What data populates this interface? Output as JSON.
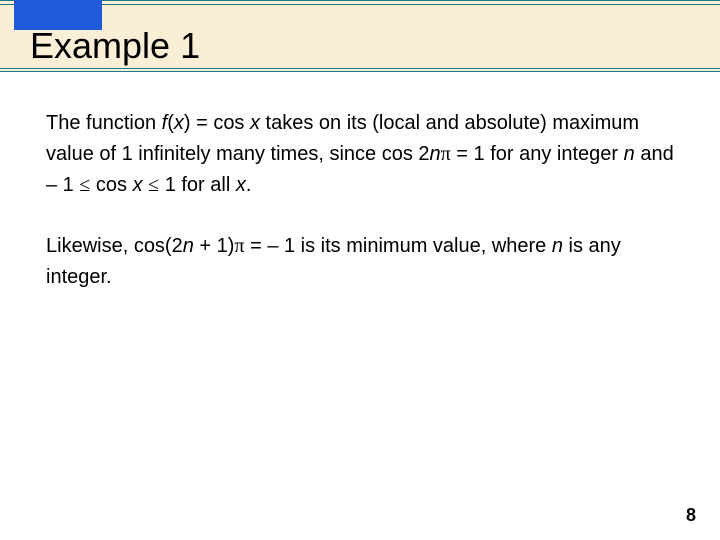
{
  "header": {
    "title": "Example 1"
  },
  "body": {
    "p1_a": "The function ",
    "p1_f": "f",
    "p1_b": "(",
    "p1_x1": "x",
    "p1_c": ") = cos ",
    "p1_x2": "x",
    "p1_d": " takes on its (local and absolute) maximum value of 1 infinitely many times, since cos 2",
    "p1_n": "n",
    "p1_pi": "π",
    "p1_e": " = 1 for any integer ",
    "p1_n2": "n",
    "p1_g": " and – 1 ",
    "p1_le1": "≤",
    "p1_h": " cos ",
    "p1_x3": "x",
    "p1_i": " ",
    "p1_le2": "≤",
    "p1_j": " 1 for all ",
    "p1_x4": "x",
    "p1_k": ".",
    "p2_a": "Likewise, cos(2",
    "p2_n": "n",
    "p2_b": " + 1)",
    "p2_pi": "π",
    "p2_c": " = – 1 is its minimum value, where ",
    "p2_n2": "n",
    "p2_d": " is any integer."
  },
  "page": {
    "number": "8"
  }
}
